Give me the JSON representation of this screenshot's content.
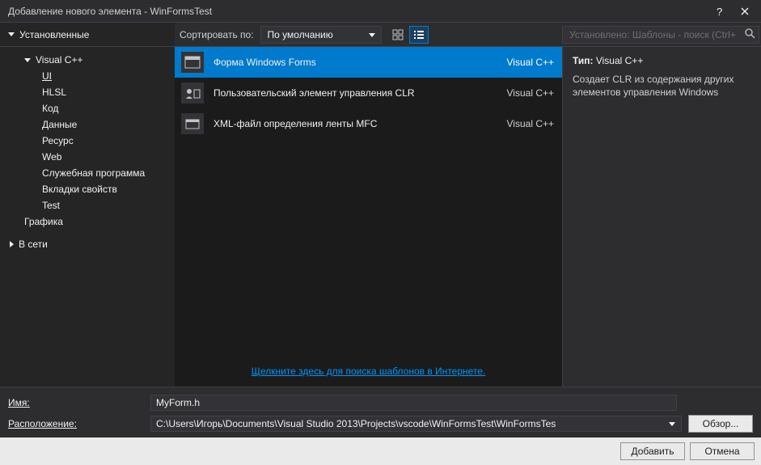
{
  "titlebar": {
    "title": "Добавление нового элемента - WinFormsTest"
  },
  "toolbar": {
    "installed_label": "Установленные",
    "sort_label": "Сортировать по:",
    "sort_value": "По умолчанию",
    "search_placeholder": "Установлено: Шаблоны - поиск (Ctrl+"
  },
  "tree": {
    "root": "Visual C++",
    "items": [
      "UI",
      "HLSL",
      "Код",
      "Данные",
      "Ресурс",
      "Web",
      "Служебная программа",
      "Вкладки свойств",
      "Test"
    ],
    "root2": "Графика",
    "online": "В сети"
  },
  "templates": [
    {
      "name": "Форма Windows Forms",
      "lang": "Visual C++",
      "selected": true
    },
    {
      "name": "Пользовательский элемент управления CLR",
      "lang": "Visual C++",
      "selected": false
    },
    {
      "name": "XML-файл определения ленты MFC",
      "lang": "Visual C++",
      "selected": false
    }
  ],
  "online_link": "Щелкните здесь для поиска шаблонов в Интернете.",
  "details": {
    "type_label": "Тип:",
    "type_value": "Visual C++",
    "description": "Создает CLR из содержания других элементов управления Windows"
  },
  "footer": {
    "name_label": "Имя:",
    "name_value": "MyForm.h",
    "location_label": "Расположение:",
    "location_value": "C:\\Users\\Игорь\\Documents\\Visual Studio 2013\\Projects\\vscode\\WinFormsTest\\WinFormsTes",
    "browse": "Обзор..."
  },
  "buttons": {
    "add": "Добавить",
    "cancel": "Отмена"
  }
}
